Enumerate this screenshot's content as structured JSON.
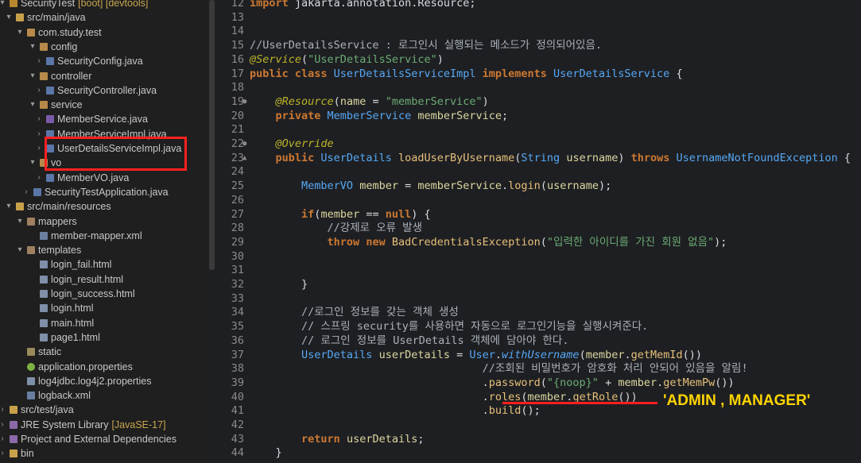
{
  "explorer": {
    "items": [
      {
        "label": "SecurityTest",
        "deco": "[boot] [devtools]",
        "icon": "project",
        "arrow": "▾"
      },
      {
        "label": "src/main/java",
        "icon": "srcfolder",
        "arrow": "▾"
      },
      {
        "label": "com.study.test",
        "icon": "package",
        "arrow": "▾"
      },
      {
        "label": "config",
        "icon": "package",
        "arrow": "▾"
      },
      {
        "label": "SecurityConfig.java",
        "icon": "java",
        "arrow": "›"
      },
      {
        "label": "controller",
        "icon": "package",
        "arrow": "▾"
      },
      {
        "label": "SecurityController.java",
        "icon": "java",
        "arrow": "›"
      },
      {
        "label": "service",
        "icon": "package",
        "arrow": "▾"
      },
      {
        "label": "MemberService.java",
        "icon": "javaint",
        "arrow": "›"
      },
      {
        "label": "MemberServiceImpl.java",
        "icon": "java",
        "arrow": "›"
      },
      {
        "label": "UserDetailsServiceImpl.java",
        "icon": "java",
        "arrow": "›"
      },
      {
        "label": "vo",
        "icon": "package",
        "arrow": "▾"
      },
      {
        "label": "MemberVO.java",
        "icon": "java",
        "arrow": "›"
      },
      {
        "label": "SecurityTestApplication.java",
        "icon": "java",
        "arrow": "›"
      },
      {
        "label": "src/main/resources",
        "icon": "srcfolder",
        "arrow": "▾"
      },
      {
        "label": "mappers",
        "icon": "packageempty",
        "arrow": "▾"
      },
      {
        "label": "member-mapper.xml",
        "icon": "xml",
        "arrow": ""
      },
      {
        "label": "templates",
        "icon": "packageempty",
        "arrow": "▾"
      },
      {
        "label": "login_fail.html",
        "icon": "html",
        "arrow": ""
      },
      {
        "label": "login_result.html",
        "icon": "html",
        "arrow": ""
      },
      {
        "label": "login_success.html",
        "icon": "html",
        "arrow": ""
      },
      {
        "label": "login.html",
        "icon": "html",
        "arrow": ""
      },
      {
        "label": "main.html",
        "icon": "html",
        "arrow": ""
      },
      {
        "label": "page1.html",
        "icon": "html",
        "arrow": ""
      },
      {
        "label": "static",
        "icon": "static",
        "arrow": ""
      },
      {
        "label": "application.properties",
        "icon": "props",
        "arrow": ""
      },
      {
        "label": "log4jdbc.log4j2.properties",
        "icon": "html",
        "arrow": ""
      },
      {
        "label": "logback.xml",
        "icon": "xml",
        "arrow": ""
      },
      {
        "label": "src/test/java",
        "icon": "srcfolder",
        "arrow": "›"
      },
      {
        "label": "JRE System Library",
        "deco": "[JavaSE-17]",
        "icon": "lib",
        "arrow": "›"
      },
      {
        "label": "Project and External Dependencies",
        "icon": "lib",
        "arrow": "›"
      },
      {
        "label": "bin",
        "icon": "bin",
        "arrow": "›"
      }
    ]
  },
  "editor": {
    "lines": [
      {
        "n": "12",
        "tokens": [
          [
            "kw",
            "import "
          ],
          [
            "tx",
            "jakarta.annotation.Resource;"
          ]
        ]
      },
      {
        "n": "13",
        "tokens": []
      },
      {
        "n": "14",
        "tokens": []
      },
      {
        "n": "15",
        "tokens": [
          [
            "cm",
            "//UserDetailsService : 로그인시 실행되는 메소드가 정의되어있음."
          ]
        ]
      },
      {
        "n": "16",
        "tokens": [
          [
            "ann",
            "@Service"
          ],
          [
            "tx",
            "("
          ],
          [
            "str",
            "\"UserDetailsService\""
          ],
          [
            "tx",
            ")"
          ]
        ]
      },
      {
        "n": "17",
        "tokens": [
          [
            "kw",
            "public class "
          ],
          [
            "ty",
            "UserDetailsServiceImpl "
          ],
          [
            "kw",
            "implements "
          ],
          [
            "ty",
            "UserDetailsService "
          ],
          [
            "tx",
            "{"
          ]
        ]
      },
      {
        "n": "18",
        "tokens": []
      },
      {
        "n": "19",
        "fold": "●",
        "tokens": [
          [
            "tx",
            "    "
          ],
          [
            "ann",
            "@Resource"
          ],
          [
            "tx",
            "("
          ],
          [
            "id",
            "name"
          ],
          [
            "tx",
            " = "
          ],
          [
            "str",
            "\"memberService\""
          ],
          [
            "tx",
            ")"
          ]
        ]
      },
      {
        "n": "20",
        "tokens": [
          [
            "tx",
            "    "
          ],
          [
            "kw",
            "private "
          ],
          [
            "ty",
            "MemberService "
          ],
          [
            "id",
            "memberService"
          ],
          [
            "tx",
            ";"
          ]
        ]
      },
      {
        "n": "21",
        "tokens": []
      },
      {
        "n": "22",
        "fold": "●",
        "tokens": [
          [
            "tx",
            "    "
          ],
          [
            "ann",
            "@Override"
          ]
        ]
      },
      {
        "n": "23",
        "fold": "▲",
        "tokens": [
          [
            "tx",
            "    "
          ],
          [
            "kw",
            "public "
          ],
          [
            "ty",
            "UserDetails "
          ],
          [
            "fn",
            "loadUserByUsername"
          ],
          [
            "tx",
            "("
          ],
          [
            "ty",
            "String "
          ],
          [
            "id",
            "username"
          ],
          [
            "tx",
            ") "
          ],
          [
            "kw",
            "throws "
          ],
          [
            "ty",
            "UsernameNotFoundException "
          ],
          [
            "tx",
            "{"
          ]
        ]
      },
      {
        "n": "24",
        "tokens": []
      },
      {
        "n": "25",
        "tokens": [
          [
            "tx",
            "        "
          ],
          [
            "ty",
            "MemberVO "
          ],
          [
            "id",
            "member"
          ],
          [
            "tx",
            " = "
          ],
          [
            "id",
            "memberService"
          ],
          [
            "tx",
            "."
          ],
          [
            "fn",
            "login"
          ],
          [
            "tx",
            "("
          ],
          [
            "id",
            "username"
          ],
          [
            "tx",
            ");"
          ]
        ]
      },
      {
        "n": "26",
        "tokens": []
      },
      {
        "n": "27",
        "tokens": [
          [
            "tx",
            "        "
          ],
          [
            "kw",
            "if"
          ],
          [
            "tx",
            "("
          ],
          [
            "id",
            "member"
          ],
          [
            "tx",
            " == "
          ],
          [
            "kw",
            "null"
          ],
          [
            "tx",
            ") {"
          ]
        ]
      },
      {
        "n": "28",
        "tokens": [
          [
            "tx",
            "            "
          ],
          [
            "cm",
            "//강제로 오류 발생"
          ]
        ]
      },
      {
        "n": "29",
        "tokens": [
          [
            "tx",
            "            "
          ],
          [
            "kw",
            "throw new "
          ],
          [
            "fn",
            "BadCredentialsException"
          ],
          [
            "tx",
            "("
          ],
          [
            "str",
            "\"입력한 아이디를 가진 회원 없음\""
          ],
          [
            "tx",
            ");"
          ]
        ]
      },
      {
        "n": "30",
        "tokens": []
      },
      {
        "n": "31",
        "tokens": []
      },
      {
        "n": "32",
        "tokens": [
          [
            "tx",
            "        }"
          ]
        ]
      },
      {
        "n": "33",
        "tokens": []
      },
      {
        "n": "34",
        "tokens": [
          [
            "tx",
            "        "
          ],
          [
            "cm",
            "//로그인 정보를 갖는 객체 생성"
          ]
        ]
      },
      {
        "n": "35",
        "tokens": [
          [
            "tx",
            "        "
          ],
          [
            "cm",
            "// 스프링 security를 사용하면 자동으로 로그인기능을 실행시켜준다."
          ]
        ]
      },
      {
        "n": "36",
        "tokens": [
          [
            "tx",
            "        "
          ],
          [
            "cm",
            "// 로그인 정보를 UserDetails 객체에 담아야 한다."
          ]
        ]
      },
      {
        "n": "37",
        "tokens": [
          [
            "tx",
            "        "
          ],
          [
            "ty",
            "UserDetails "
          ],
          [
            "id",
            "userDetails"
          ],
          [
            "tx",
            " = "
          ],
          [
            "ty",
            "User"
          ],
          [
            "tx",
            "."
          ],
          [
            "cls",
            "withUsername"
          ],
          [
            "tx",
            "("
          ],
          [
            "id",
            "member"
          ],
          [
            "tx",
            "."
          ],
          [
            "fn",
            "getMemId"
          ],
          [
            "tx",
            "())"
          ]
        ]
      },
      {
        "n": "38",
        "tokens": [
          [
            "tx",
            "                                    "
          ],
          [
            "cm",
            "//조회된 비밀번호가 암호화 처리 안되어 있음을 알림!"
          ]
        ]
      },
      {
        "n": "39",
        "tokens": [
          [
            "tx",
            "                                    ."
          ],
          [
            "fn",
            "password"
          ],
          [
            "tx",
            "("
          ],
          [
            "str",
            "\"{noop}\""
          ],
          [
            "tx",
            " + "
          ],
          [
            "id",
            "member"
          ],
          [
            "tx",
            "."
          ],
          [
            "fn",
            "getMemPw"
          ],
          [
            "tx",
            "())"
          ]
        ]
      },
      {
        "n": "40",
        "tokens": [
          [
            "tx",
            "                                    ."
          ],
          [
            "fn",
            "roles"
          ],
          [
            "tx",
            "("
          ],
          [
            "id",
            "member"
          ],
          [
            "tx",
            "."
          ],
          [
            "fn",
            "getRole"
          ],
          [
            "tx",
            "())"
          ]
        ]
      },
      {
        "n": "41",
        "tokens": [
          [
            "tx",
            "                                    ."
          ],
          [
            "fn",
            "build"
          ],
          [
            "tx",
            "();"
          ]
        ]
      },
      {
        "n": "42",
        "tokens": []
      },
      {
        "n": "43",
        "tokens": [
          [
            "tx",
            "        "
          ],
          [
            "kw",
            "return "
          ],
          [
            "id",
            "userDetails"
          ],
          [
            "tx",
            ";"
          ]
        ]
      },
      {
        "n": "44",
        "tokens": [
          [
            "tx",
            "    }"
          ]
        ]
      }
    ]
  },
  "annotation": {
    "text": "'ADMIN , MANAGER'",
    "color": "#ffd400"
  },
  "colors": {
    "highlight": "#ff2020"
  }
}
